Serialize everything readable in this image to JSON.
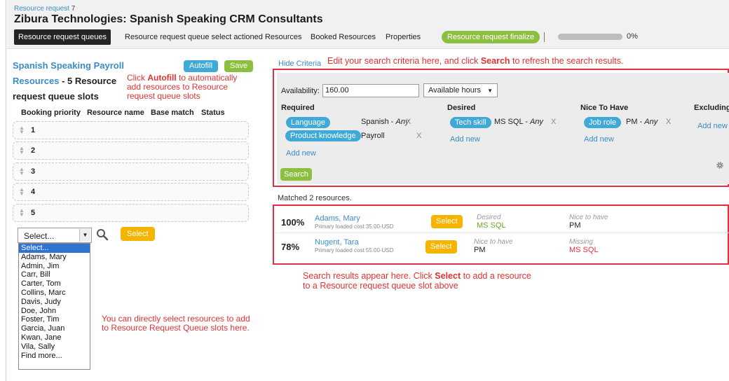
{
  "header": {
    "crumb_label": "Resource request",
    "crumb_number": "7",
    "title": "Zibura Technologies: Spanish Speaking CRM Consultants",
    "tabs": [
      {
        "label": "Resource request queues"
      },
      {
        "label": "Resource request queue select actioned Resources"
      },
      {
        "label": "Booked Resources"
      },
      {
        "label": "Properties"
      }
    ],
    "finalize_label": "Resource request finalize",
    "progress_value": 0,
    "progress_label": "0%"
  },
  "left": {
    "title": "Spanish Speaking Payroll",
    "resources_word": "Resources",
    "resources_rest": " - 5 Resource",
    "slots_line": "request queue slots",
    "autofill_label": "Autofill",
    "save_label": "Save",
    "note_autofill_pre": "Click ",
    "note_autofill_bold": "Autofill",
    "note_autofill_post": " to automatically",
    "note_line2": "add resources to Resource",
    "note_line3": "request queue slots",
    "columns": [
      "Booking priority",
      "Resource name",
      "Base match",
      "Status"
    ],
    "slots": [
      "1",
      "2",
      "3",
      "4",
      "5"
    ],
    "select_value": "Select...",
    "select_button": "Select",
    "dropdown_options": [
      "Select...",
      "Adams, Mary",
      "Admin, Jim",
      "Carr, Bill",
      "Carter, Tom",
      "Collins, Marc",
      "Davis, Judy",
      "Doe, John",
      "Foster, Tim",
      "Garcia, Juan",
      "Kwan, Jane",
      "Vila, Sally",
      "Find more..."
    ],
    "note_direct_1": "You can directly select resources to add",
    "note_direct_2": "to Resource Request Queue slots here."
  },
  "criteria": {
    "hide_label": "Hide Criteria",
    "note_pre": "Edit your search criteria here, and click ",
    "note_bold": "Search",
    "note_post": " to refresh the search results.",
    "availability_label": "Availability:",
    "availability_value": "160.00",
    "unit_value": "Available hours",
    "required_head": "Required",
    "desired_head": "Desired",
    "nice_head": "Nice To Have",
    "excluding_head": "Excluding",
    "req1_tag": "Language",
    "req1_value": "Spanish - ",
    "req1_any": "Any",
    "req2_tag": "Product knowledge",
    "req2_value": "Payroll",
    "des1_tag": "Tech skill",
    "des1_value": "MS SQL - ",
    "des1_any": "Any",
    "nice1_tag": "Job role",
    "nice1_value": "PM - ",
    "nice1_any": "Any",
    "remove": "X",
    "add_new": "Add new",
    "search_label": "Search"
  },
  "results": {
    "matched_text": "Matched 2 resources.",
    "rows": [
      {
        "pct": "100%",
        "name": "Adams, Mary",
        "cost": "Primary loaded cost 35.00-USD",
        "select": "Select",
        "m1_label": "Desired",
        "m1_value": "MS SQL",
        "m2_label": "Nice to have",
        "m2_value": "PM"
      },
      {
        "pct": "78%",
        "name": "Nugent, Tara",
        "cost": "Primary loaded cost 55.00-USD",
        "select": "Select",
        "m1_label": "Nice to have",
        "m1_value": "PM",
        "m2_label": "Missing",
        "m2_value": "MS SQL"
      }
    ],
    "note_pre": "Search results appear here. Click ",
    "note_bold": "Select",
    "note_post": " to add a resource",
    "note_line2": "to a Resource request queue slot above"
  },
  "colors": {
    "accent_blue": "#3fa9d8",
    "green": "#8cbf3f",
    "orange": "#f4b400",
    "annotation_red": "#e23040"
  }
}
